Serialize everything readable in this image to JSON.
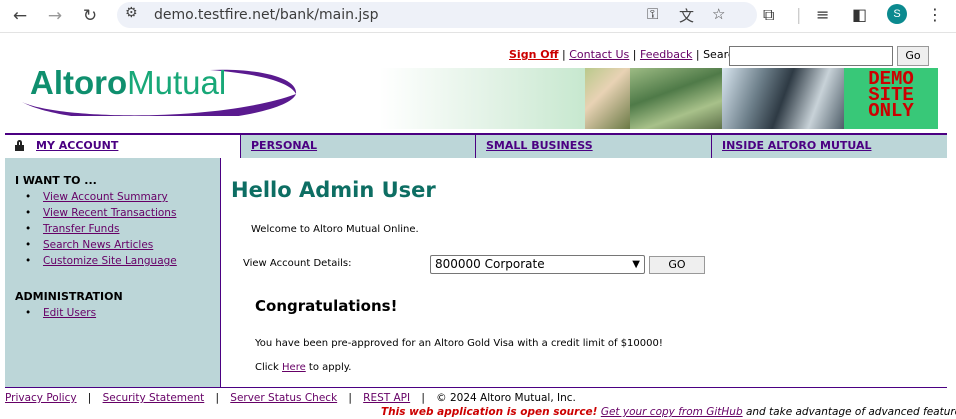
{
  "browser": {
    "url": "demo.testfire.net/bank/main.jsp",
    "profile_initial": "S",
    "icons": [
      "back-icon",
      "forward-icon",
      "reload-icon",
      "site-info-icon",
      "key-icon",
      "translate-icon",
      "star-icon",
      "extensions-icon",
      "media-icon",
      "sidepanel-icon",
      "avatar",
      "menu-icon"
    ]
  },
  "header": {
    "sign_off": "Sign Off",
    "contact_us": "Contact Us",
    "feedback": "Feedback",
    "search_label": "Search",
    "search_value": "",
    "search_go": "Go",
    "logo_altoro": "Altoro",
    "logo_mutual": "Mutual",
    "demo_line1": "DEMO",
    "demo_line2": "SITE",
    "demo_line3": "ONLY"
  },
  "tabs": [
    {
      "label": "MY ACCOUNT"
    },
    {
      "label": "PERSONAL"
    },
    {
      "label": "SMALL BUSINESS"
    },
    {
      "label": "INSIDE ALTORO MUTUAL"
    }
  ],
  "sidebar": {
    "i_want_to": "I WANT TO ...",
    "links": [
      {
        "label": "View Account Summary"
      },
      {
        "label": "View Recent Transactions"
      },
      {
        "label": "Transfer Funds"
      },
      {
        "label": "Search News Articles"
      },
      {
        "label": "Customize Site Language"
      }
    ],
    "admin_heading": "ADMINISTRATION",
    "admin_links": [
      {
        "label": "Edit Users"
      }
    ]
  },
  "main": {
    "greeting": "Hello Admin User",
    "welcome": "Welcome to Altoro Mutual Online.",
    "view_account_label": "View Account Details:",
    "selected_account": "800000 Corporate",
    "go_label": "GO",
    "congrats": "Congratulations!",
    "preapproved": "You have been pre-approved for an Altoro Gold Visa with a credit limit of $10000!",
    "click": "Click",
    "here": "Here",
    "to_apply": "to apply."
  },
  "footer": {
    "privacy": "Privacy Policy",
    "security": "Security Statement",
    "status": "Server Status Check",
    "rest": "REST API",
    "copyright": "© 2024 Altoro Mutual, Inc.",
    "notice_red": "This web application is open source!",
    "notice_link": "Get your copy from GitHub",
    "notice_tail": "and take advantage of advanced features"
  }
}
